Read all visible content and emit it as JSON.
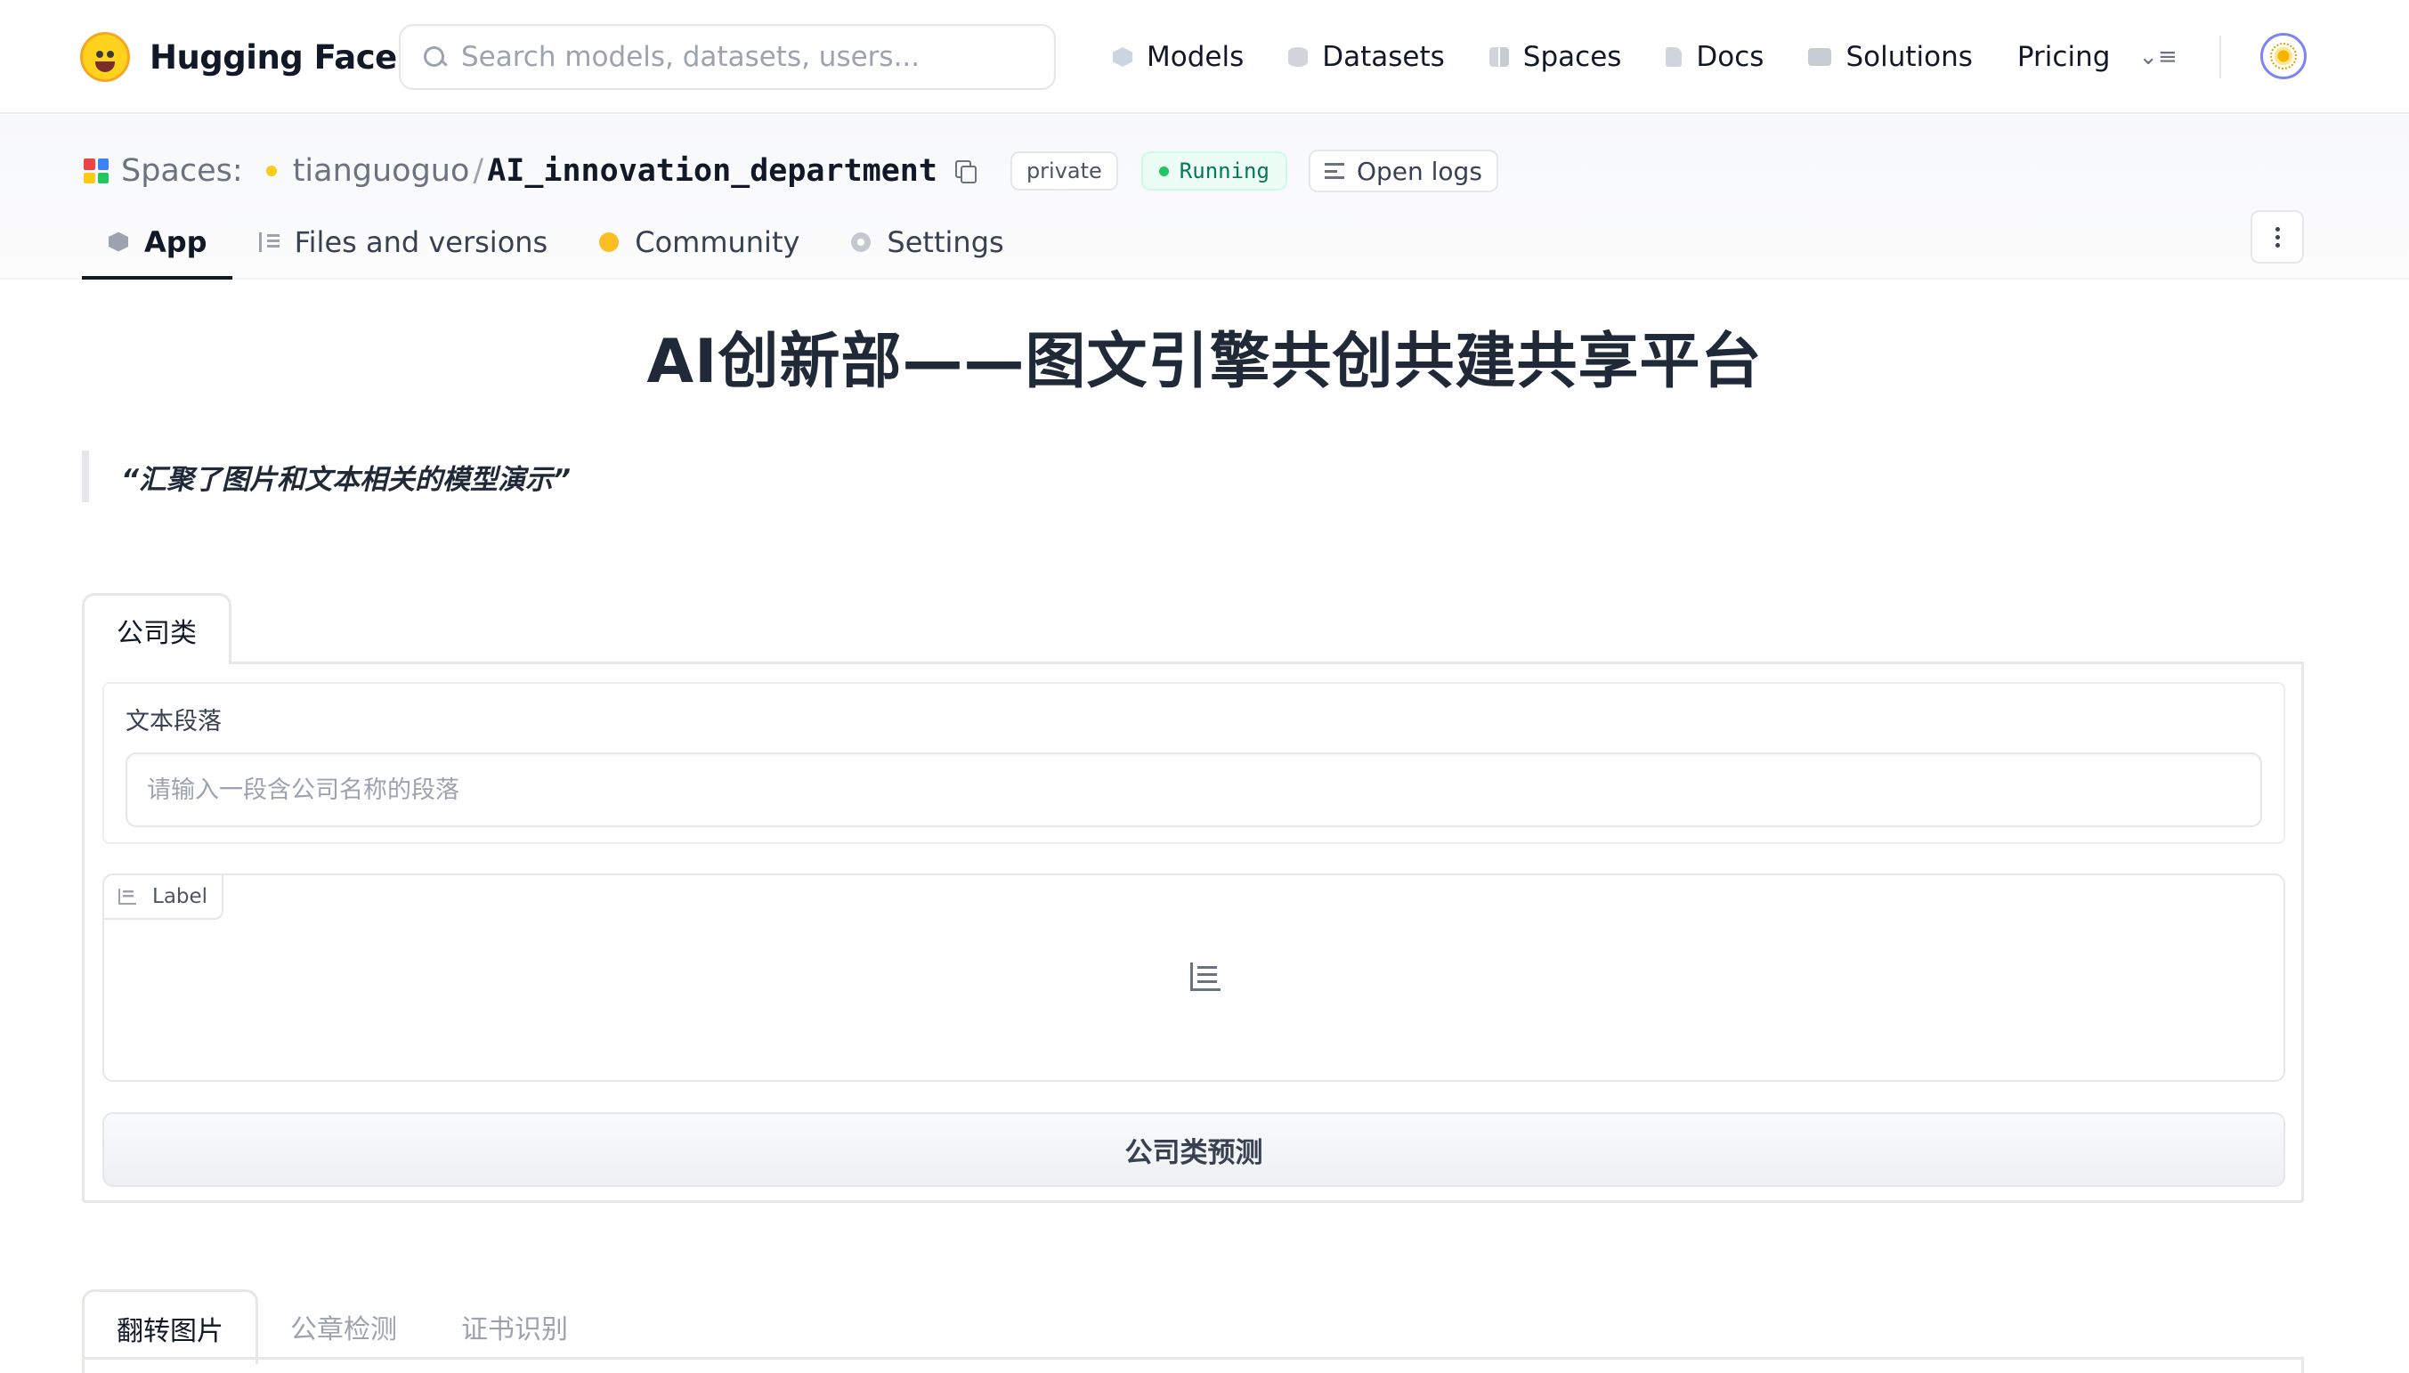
{
  "nav": {
    "brand": "Hugging Face",
    "search_placeholder": "Search models, datasets, users...",
    "links": [
      "Models",
      "Datasets",
      "Spaces",
      "Docs",
      "Solutions",
      "Pricing"
    ]
  },
  "space": {
    "crumb_label": "Spaces:",
    "owner": "tianguoguo",
    "separator": "/",
    "repo": "AI_innovation_department",
    "visibility": "private",
    "status": "Running",
    "logs_label": "Open logs",
    "tabs": [
      "App",
      "Files and versions",
      "Community",
      "Settings"
    ]
  },
  "app": {
    "title": "AI创新部——图文引擎共创共建共享平台",
    "quote": "“汇聚了图片和文本相关的模型演示”",
    "panel_tab": "公司类",
    "textbox_label": "文本段落",
    "textbox_placeholder": "请输入一段含公司名称的段落",
    "output_label": "Label",
    "predict_button": "公司类预测",
    "bottom_tabs": [
      "翻转图片",
      "公章检测",
      "证书识别"
    ]
  },
  "colors": {
    "running_bg": "#ecfdf5",
    "running_text": "#047857",
    "accent_user": "#facc15"
  }
}
